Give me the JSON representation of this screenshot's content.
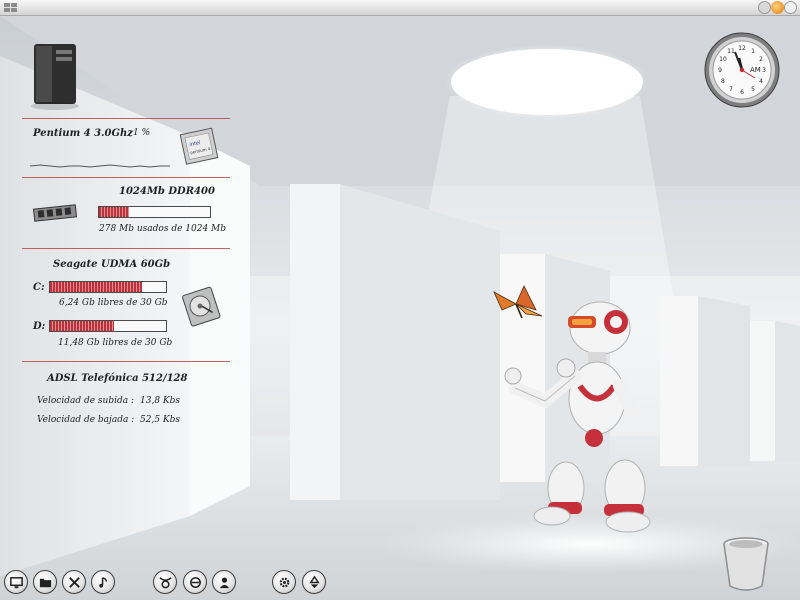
{
  "cpu": {
    "name": "Pentium 4  3.0Ghz",
    "usage": "1 %"
  },
  "memory": {
    "title": "1024Mb DDR400",
    "used_text": "278 Mb usados de 1024 Mb",
    "used_fraction": 0.271
  },
  "disk": {
    "title": "Seagate UDMA 60Gb",
    "drives": [
      {
        "letter": "C:",
        "text": "6,24 Gb libres  de 30 Gb",
        "used_fraction": 0.79
      },
      {
        "letter": "D:",
        "text": "11,48 Gb libres  de 30 Gb",
        "used_fraction": 0.55
      }
    ]
  },
  "network": {
    "title": "ADSL Telefónica   512/128",
    "upload_label": "Velocidad de subida :",
    "upload_value": "13,8 Kbs",
    "download_label": "Velocidad de bajada :",
    "download_value": "52,5 Kbs"
  },
  "clock": {
    "period": "AM",
    "numerals": [
      "12",
      "1",
      "2",
      "3",
      "4",
      "5",
      "6",
      "7",
      "8",
      "9",
      "10",
      "11"
    ]
  },
  "dock": {
    "left_group": [
      "desktop-icon",
      "folder-icon",
      "tools-icon",
      "music-note-icon"
    ],
    "middle_group": [
      "taurus-icon",
      "internet-explorer-icon",
      "user-icon"
    ],
    "right_group": [
      "gear-icon",
      "recycle-icon"
    ]
  },
  "colors": {
    "accent_red": "#b8343c",
    "separator": "#b74848",
    "panel_text": "#222222"
  }
}
